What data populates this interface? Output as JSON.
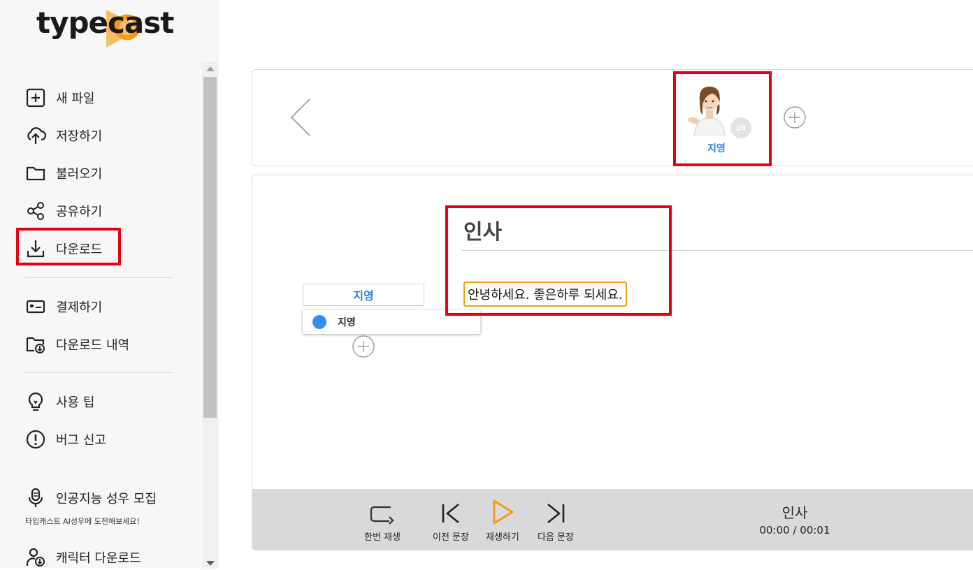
{
  "app": {
    "logo_text": "typecast"
  },
  "sidebar": {
    "items": [
      {
        "label": "새 파일",
        "icon": "plus-square-icon"
      },
      {
        "label": "저장하기",
        "icon": "cloud-upload-icon"
      },
      {
        "label": "불러오기",
        "icon": "folder-icon"
      },
      {
        "label": "공유하기",
        "icon": "share-icon"
      },
      {
        "label": "다운로드",
        "icon": "download-icon"
      },
      {
        "label": "결제하기",
        "icon": "credit-card-icon"
      },
      {
        "label": "다운로드 내역",
        "icon": "folder-download-icon"
      },
      {
        "label": "사용 팁",
        "icon": "lightbulb-icon"
      },
      {
        "label": "버그 신고",
        "icon": "alert-circle-icon"
      },
      {
        "label": "인공지능 성우 모집",
        "icon": "microphone-icon"
      },
      {
        "label": "캐릭터 다운로드",
        "icon": "user-download-icon"
      }
    ],
    "voice_recruit_note": "타입캐스트 AI성우에 도전해보세요!"
  },
  "character_bar": {
    "selected_character": "지영",
    "icons": {
      "back": "chevron-left-icon",
      "swap": "swap-icon",
      "add": "add-circle-icon"
    }
  },
  "script": {
    "title": "인사",
    "speaker_selected": "지영",
    "speaker_options": [
      "지영"
    ],
    "sentence": "안녕하세요. 좋은하루 되세요."
  },
  "player": {
    "buttons": [
      {
        "label": "한번 재생",
        "icon": "repeat-once-icon"
      },
      {
        "label": "이전 문장",
        "icon": "previous-icon"
      },
      {
        "label": "재생하기",
        "icon": "play-icon"
      },
      {
        "label": "다음 문장",
        "icon": "next-icon"
      }
    ],
    "now_playing_title": "인사",
    "time": "00:00 / 00:01"
  },
  "colors": {
    "accent_blue": "#2b7de9",
    "play_orange": "#f39a1a",
    "highlight_red": "#e60012",
    "sentence_border": "#f0a30a",
    "sidebar_bg": "#f7f7f7",
    "player_bg": "#d9d9d9"
  }
}
